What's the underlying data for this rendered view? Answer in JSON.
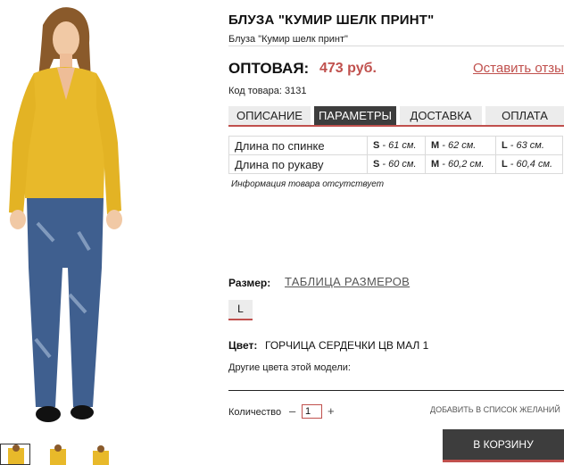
{
  "product": {
    "title": "БЛУЗА \"КУМИР ШЕЛК ПРИНТ\"",
    "subtitle": "Блуза \"Кумир шелк принт\"",
    "price_label": "ОПТОВАЯ:",
    "price_value": "473 руб.",
    "review_link": "Оставить отзыв",
    "code": "Код товара: 3131"
  },
  "tabs": [
    {
      "label": "ОПИСАНИЕ",
      "active": false
    },
    {
      "label": "ПАРАМЕТРЫ",
      "active": true
    },
    {
      "label": "ДОСТАВКА",
      "active": false
    },
    {
      "label": "ОПЛАТА",
      "active": false
    }
  ],
  "params": [
    {
      "name": "Длина по спинке",
      "s_key": "S",
      "s_val": " - 61 см.",
      "m_key": "M",
      "m_val": " - 62 см.",
      "l_key": "L",
      "l_val": " - 63 см."
    },
    {
      "name": "Длина по рукаву",
      "s_key": "S",
      "s_val": " - 60 см.",
      "m_key": "M",
      "m_val": " - 60,2 см.",
      "l_key": "L",
      "l_val": " - 60,4 см."
    }
  ],
  "info_note": "Информация товара отсутствует",
  "size": {
    "label": "Размер:",
    "table_link": "ТАБЛИЦА РАЗМЕРОВ",
    "options": [
      "L"
    ]
  },
  "color": {
    "label": "Цвет:",
    "value": "ГОРЧИЦА СЕРДЕЧКИ ЦВ МАЛ 1"
  },
  "other_colors": "Другие цвета этой модели:",
  "quantity": {
    "label": "Количество",
    "minus": "–",
    "value": "1",
    "plus": "+"
  },
  "wishlist": "ДОБАВИТЬ В СПИСОК ЖЕЛАНИЙ",
  "cart_button": "В КОРЗИНУ",
  "colors": {
    "accent": "#c0504d",
    "dark": "#3d3d3d",
    "tab_bg": "#ececec",
    "blouse": "#e8b92a",
    "jeans": "#3f5f8f"
  }
}
